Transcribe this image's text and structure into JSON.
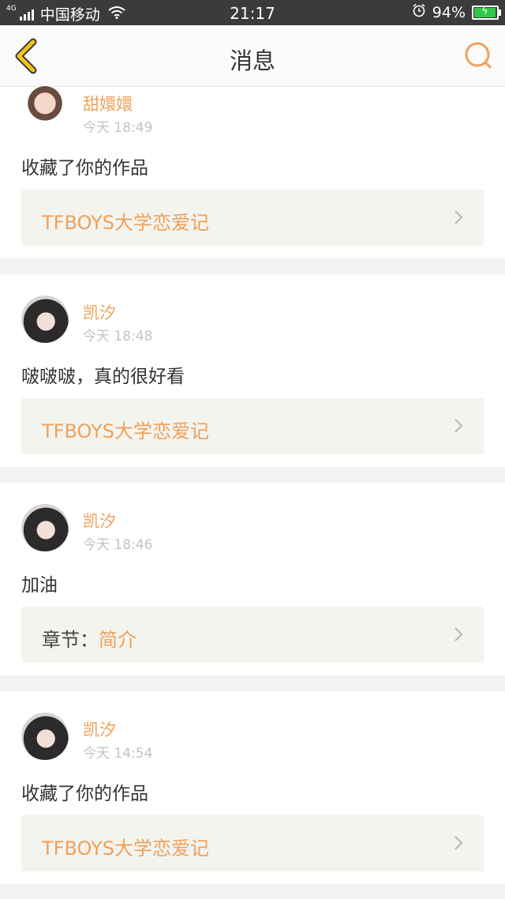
{
  "status_bar": {
    "network": "4G",
    "carrier": "中国移动",
    "time": "21:17",
    "battery_percent": "94%"
  },
  "nav": {
    "title": "消息"
  },
  "colors": {
    "accent": "#f0a05a",
    "back_icon": "#f3c21c",
    "status_bar": "#3b3b3b"
  },
  "notifications": [
    {
      "user": "甜嬛嬛",
      "time": "今天 18:49",
      "message": "收藏了你的作品",
      "ref_prefix": "",
      "ref_title": "TFBOYS大学恋爱记"
    },
    {
      "user": "凯汐",
      "time": "今天 18:48",
      "message": "啵啵啵，真的很好看",
      "ref_prefix": "",
      "ref_title": "TFBOYS大学恋爱记"
    },
    {
      "user": "凯汐",
      "time": "今天 18:46",
      "message": "加油",
      "ref_prefix": "章节：",
      "ref_title": "简介"
    },
    {
      "user": "凯汐",
      "time": "今天 14:54",
      "message": "收藏了你的作品",
      "ref_prefix": "",
      "ref_title": "TFBOYS大学恋爱记"
    }
  ]
}
